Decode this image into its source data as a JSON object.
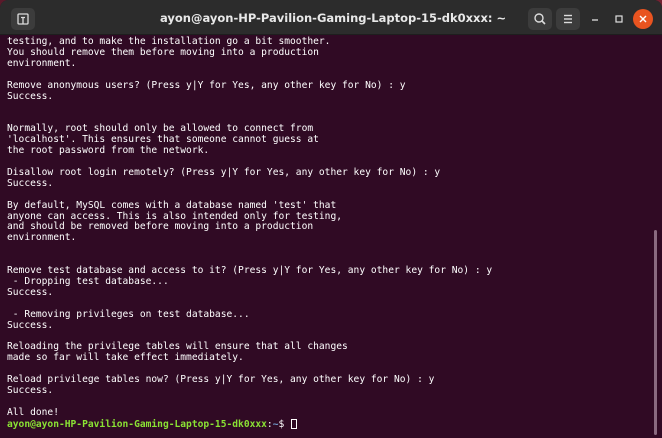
{
  "window": {
    "title": "ayon@ayon-HP-Pavilion-Gaming-Laptop-15-dk0xxx: ~"
  },
  "icons": {
    "new_tab": "new-tab-icon",
    "search": "search-icon",
    "menu": "hamburger-menu-icon",
    "minimize": "minimize-icon",
    "maximize": "maximize-icon",
    "close": "close-icon"
  },
  "colors": {
    "terminal_bg": "#300a24",
    "prompt_user": "#8ae234",
    "prompt_path": "#729fcf",
    "close_button": "#e95420"
  },
  "terminal": {
    "lines": [
      "testing, and to make the installation go a bit smoother.",
      "You should remove them before moving into a production",
      "environment.",
      "",
      "Remove anonymous users? (Press y|Y for Yes, any other key for No) : y",
      "Success.",
      "",
      "",
      "Normally, root should only be allowed to connect from",
      "'localhost'. This ensures that someone cannot guess at",
      "the root password from the network.",
      "",
      "Disallow root login remotely? (Press y|Y for Yes, any other key for No) : y",
      "Success.",
      "",
      "By default, MySQL comes with a database named 'test' that",
      "anyone can access. This is also intended only for testing,",
      "and should be removed before moving into a production",
      "environment.",
      "",
      "",
      "Remove test database and access to it? (Press y|Y for Yes, any other key for No) : y",
      " - Dropping test database...",
      "Success.",
      "",
      " - Removing privileges on test database...",
      "Success.",
      "",
      "Reloading the privilege tables will ensure that all changes",
      "made so far will take effect immediately.",
      "",
      "Reload privilege tables now? (Press y|Y for Yes, any other key for No) : y",
      "Success.",
      "",
      "All done!"
    ],
    "prompt": {
      "user_host": "ayon@ayon-HP-Pavilion-Gaming-Laptop-15-dk0xxx",
      "separator": ":",
      "path": "~",
      "symbol": "$ "
    }
  }
}
